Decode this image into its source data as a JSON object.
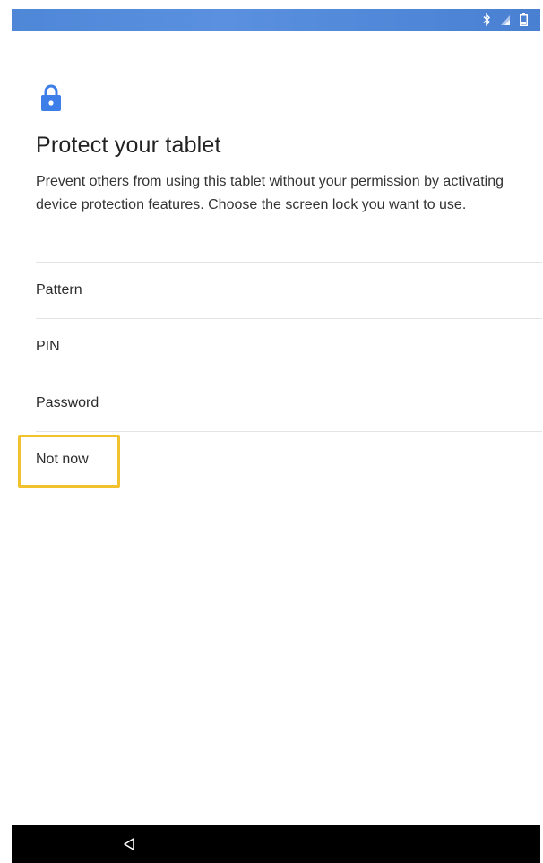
{
  "status_bar": {
    "background": "#4f87d8",
    "icons": [
      "bluetooth-icon",
      "signal-icon",
      "battery-icon"
    ]
  },
  "lock_icon": {
    "name": "lock-icon",
    "color": "#3d7ee8"
  },
  "screen": {
    "title": "Protect your tablet",
    "description": "Prevent others from using this tablet without your permission by activating device protection features. Choose the screen lock you want to use."
  },
  "options": [
    {
      "label": "Pattern"
    },
    {
      "label": "PIN"
    },
    {
      "label": "Password"
    },
    {
      "label": "Not now"
    }
  ],
  "highlight": {
    "color": "#f2c12e",
    "target": "Not now"
  },
  "nav_bar": {
    "background": "#000000",
    "icons": [
      "back-icon"
    ]
  }
}
